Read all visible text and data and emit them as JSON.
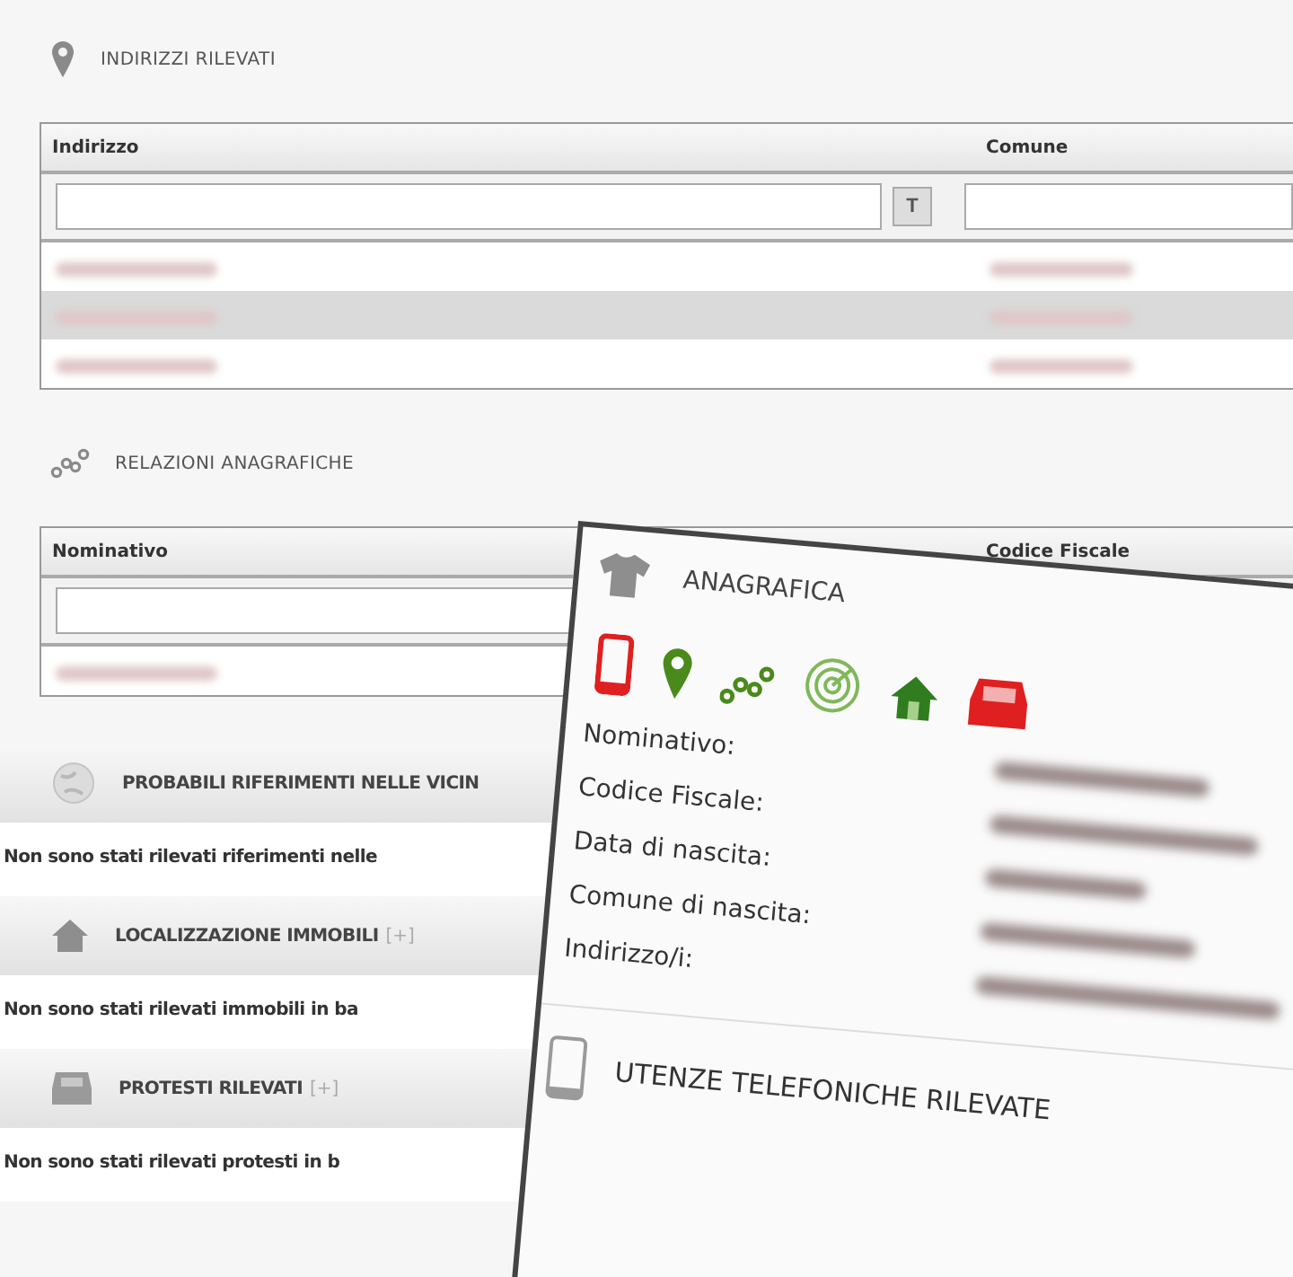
{
  "sections": [
    {
      "kind": "table",
      "title": "INDIRIZZI RILEVATI",
      "columns": [
        {
          "label": "Indirizzo",
          "filter_button": "T"
        },
        {
          "label": "Comune"
        }
      ],
      "rows": [
        {
          "striped": false
        },
        {
          "striped": true
        },
        {
          "striped": false
        }
      ]
    },
    {
      "kind": "table",
      "title": "RELAZIONI ANAGRAFICHE",
      "columns": [
        {
          "label": "Nominativo"
        },
        {
          "label": "Codice Fiscale"
        }
      ],
      "rows": [
        {
          "striped": false
        }
      ]
    },
    {
      "kind": "collapsible",
      "title": "PROBABILI RIFERIMENTI NELLE VICIN",
      "message": "Non sono stati rilevati riferimenti nelle"
    },
    {
      "kind": "collapsible",
      "title": "LOCALIZZAZIONE IMMOBILI",
      "toggle": "[+]",
      "message": "Non sono stati rilevati immobili in ba"
    },
    {
      "kind": "collapsible",
      "title": "PROTESTI RILEVATI",
      "toggle": "[+]",
      "message": "Non sono stati rilevati protesti in b"
    }
  ],
  "card": {
    "title": "ANAGRAFICA",
    "indicators": [
      {
        "kind": "phone",
        "color": "#e02020"
      },
      {
        "kind": "pin",
        "color": "#4a8a1c"
      },
      {
        "kind": "relations",
        "color": "#4a8a1c"
      },
      {
        "kind": "radar",
        "color": "#7fb85a"
      },
      {
        "kind": "house",
        "color": "#2f7d1e"
      },
      {
        "kind": "inbox",
        "color": "#e02020"
      }
    ],
    "fields": [
      {
        "label": "Nominativo:"
      },
      {
        "label": "Codice Fiscale:"
      },
      {
        "label": "Data di nascita:"
      },
      {
        "label": "Comune di nascita:"
      },
      {
        "label": "Indirizzo/i:"
      }
    ],
    "footer_title": "UTENZE TELEFONICHE RILEVATE"
  }
}
